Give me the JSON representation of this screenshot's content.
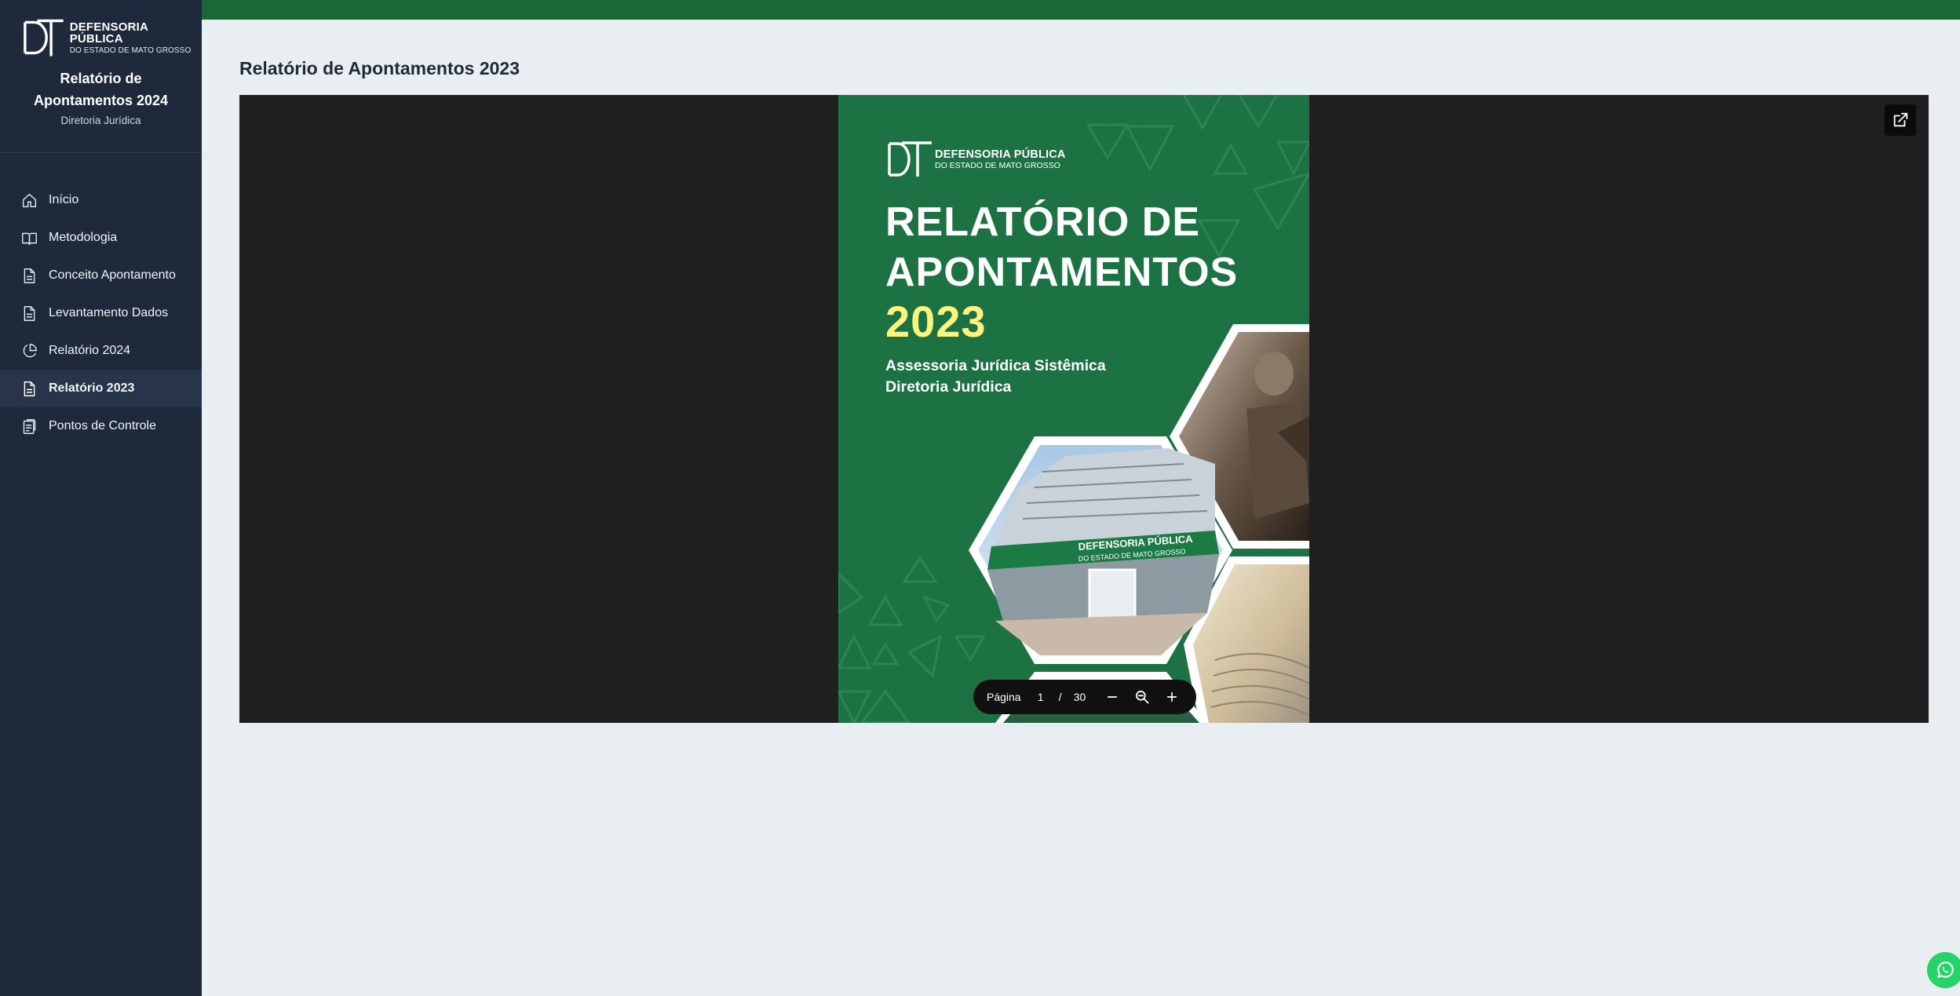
{
  "brand": {
    "logo_line1": "DEFENSORIA PÚBLICA",
    "logo_line2": "DO ESTADO DE MATO GROSSO",
    "app_title_line1": "Relatório de",
    "app_title_line2": "Apontamentos 2024",
    "subtitle": "Diretoria Jurídica"
  },
  "sidebar": {
    "items": [
      {
        "label": "Início",
        "icon": "home-icon"
      },
      {
        "label": "Metodologia",
        "icon": "book-icon"
      },
      {
        "label": "Conceito Apontamento",
        "icon": "document-icon"
      },
      {
        "label": "Levantamento Dados",
        "icon": "document-icon"
      },
      {
        "label": "Relatório 2024",
        "icon": "pie-chart-icon"
      },
      {
        "label": "Relatório 2023",
        "icon": "document-icon",
        "active": true
      },
      {
        "label": "Pontos de Controle",
        "icon": "clipboard-icon"
      }
    ]
  },
  "main": {
    "title": "Relatório de Apontamentos 2023"
  },
  "pdf": {
    "logo_line1": "DEFENSORIA PÚBLICA",
    "logo_line2": "DO ESTADO DE MATO GROSSO",
    "title_line1": "RELATÓRIO DE",
    "title_line2": "APONTAMENTOS",
    "year": "2023",
    "sub_line1": "Assessoria Jurídica Sistêmica",
    "sub_line2": "Diretoria Jurídica",
    "building_sign_line1": "DEFENSORIA PÚBLICA",
    "building_sign_line2": "DO ESTADO DE MATO GROSSO"
  },
  "pager": {
    "label": "Página",
    "current": "1",
    "separator": "/",
    "total": "30"
  },
  "colors": {
    "sidebar_bg": "#1e293b",
    "topbar": "#1a6833",
    "pdf_green": "#1d7244",
    "year_yellow": "#fdf37f",
    "whatsapp": "#25d366"
  }
}
